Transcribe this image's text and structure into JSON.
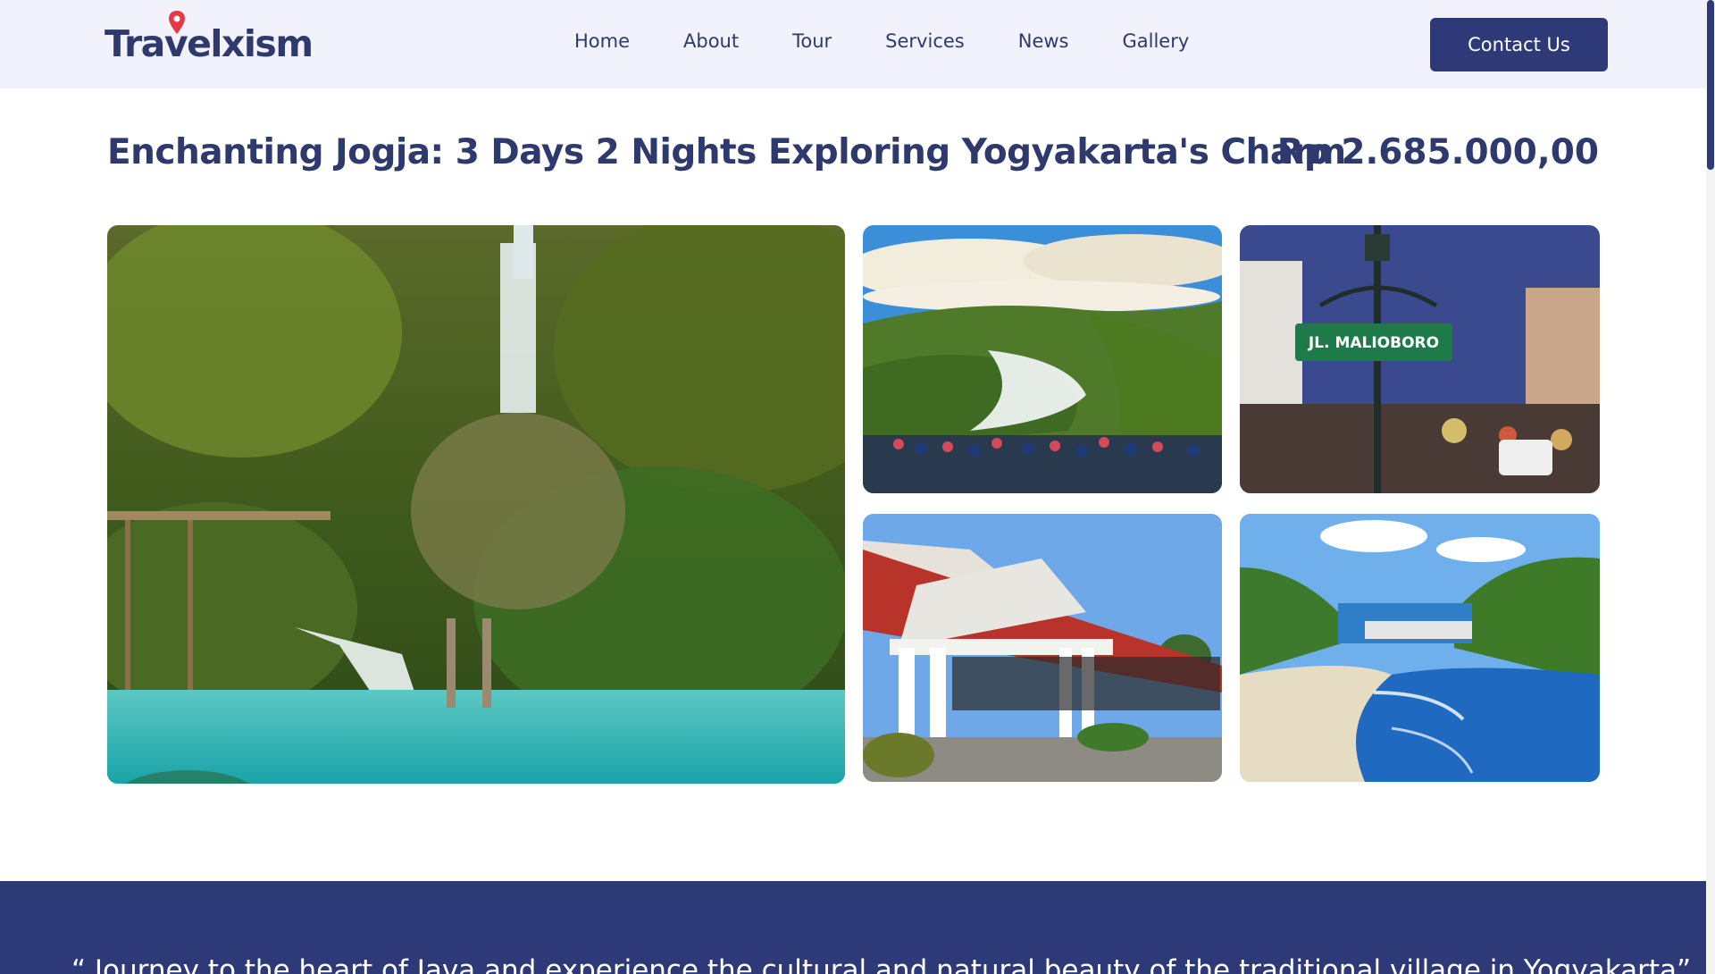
{
  "header": {
    "logo_text": "Travelxism",
    "nav": [
      "Home",
      "About",
      "Tour",
      "Services",
      "News",
      "Gallery"
    ],
    "contact_label": "Contact Us"
  },
  "tour": {
    "title": "Enchanting Jogja: 3 Days 2 Nights Exploring Yogyakarta's Charm",
    "price": "Rp 2.685.000,00"
  },
  "gallery": {
    "street_sign": "JL. MALIOBORO"
  },
  "banner": {
    "quote": "“ Journey to the heart of Java and experience the cultural and natural beauty of the traditional village in Yogyakarta”"
  },
  "colors": {
    "brand": "#2e3a78",
    "header_bg": "#f1f2fb",
    "pin": "#e63946"
  }
}
